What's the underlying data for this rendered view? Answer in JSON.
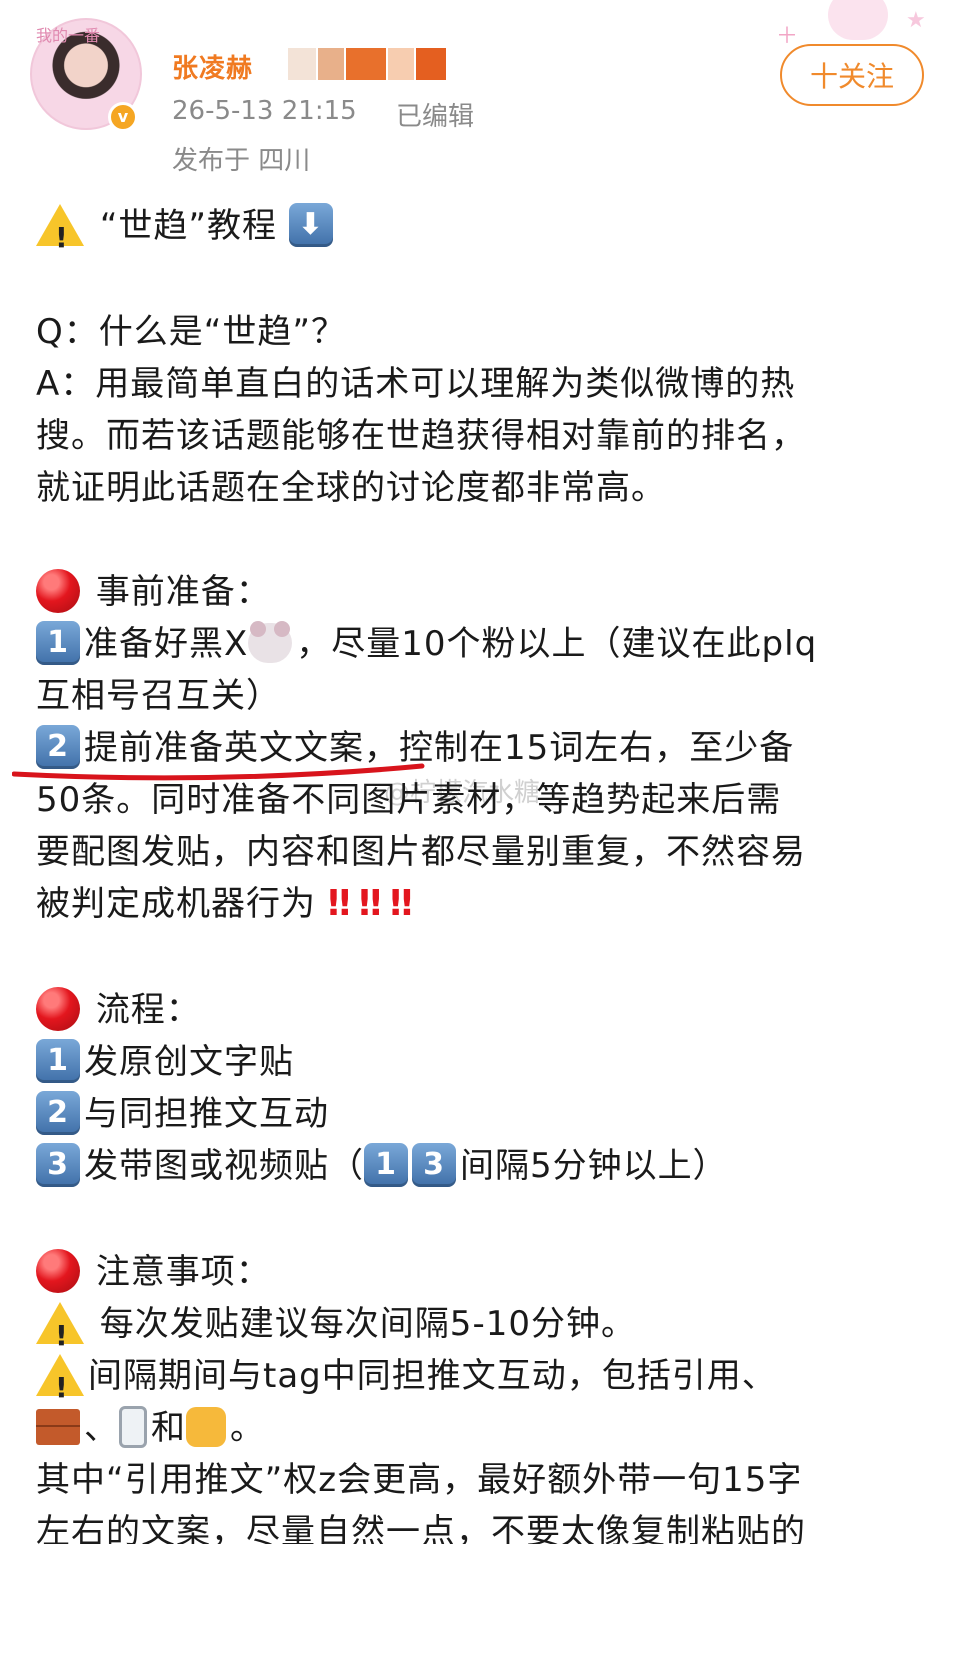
{
  "header": {
    "avatar_sticker": "我的一番",
    "username": "张凌赫",
    "timestamp": "26-5-13 21:15",
    "edited": "已编辑",
    "location": "发布于 四川",
    "follow_label": "十关注"
  },
  "post": {
    "title": "“世趋”教程",
    "q": "Q：什么是“世趋”？",
    "a1": "A：用最简单直白的话术可以理解为类似微博的热",
    "a2": "搜。而若该话题能够在世趋获得相对靠前的排名，",
    "a3": "就证明此话题在全球的讨论度都非常高。",
    "prep_heading": "事前准备：",
    "prep1_a": "准备好黑X",
    "prep1_b": "，尽量10个粉以上（建议在此plq",
    "prep1_c": "互相号召互关）",
    "prep2_a": "提前准备英文文案，控制在15词左右，至少备",
    "prep2_b": "50条。同时准备不同图片素材，等趋势起来后需",
    "prep2_c": "要配图发贴，内容和图片都尽量别重复，不然容易",
    "prep2_d": "被判定成机器行为",
    "flow_heading": "流程：",
    "flow1": "发原创文字贴",
    "flow2": "与同担推文互动",
    "flow3_a": "发带图或视频贴（",
    "flow3_b": "间隔5分钟以上）",
    "notes_heading": "注意事项：",
    "note1": " 每次发贴建议每次间隔5-10分钟。",
    "note2": "间隔期间与tag中同担推文互动，包括引用、",
    "note3_a": "、",
    "note3_b": "和",
    "note3_c": "。",
    "note4": "其中“引用推文”权z会更高，最好额外带一句15字",
    "note5": "左右的文案，尽量自然一点，不要太像复制粘贴的"
  },
  "watermark": "@柠檬汽水糖",
  "keycaps": {
    "k1": "1",
    "k2": "2",
    "k3": "3",
    "down": "⬇"
  },
  "bangs": "‼ ‼ ‼",
  "colors": {
    "accent": "#f08a2c",
    "meta": "#8a8a8a",
    "red": "#e3161e"
  }
}
